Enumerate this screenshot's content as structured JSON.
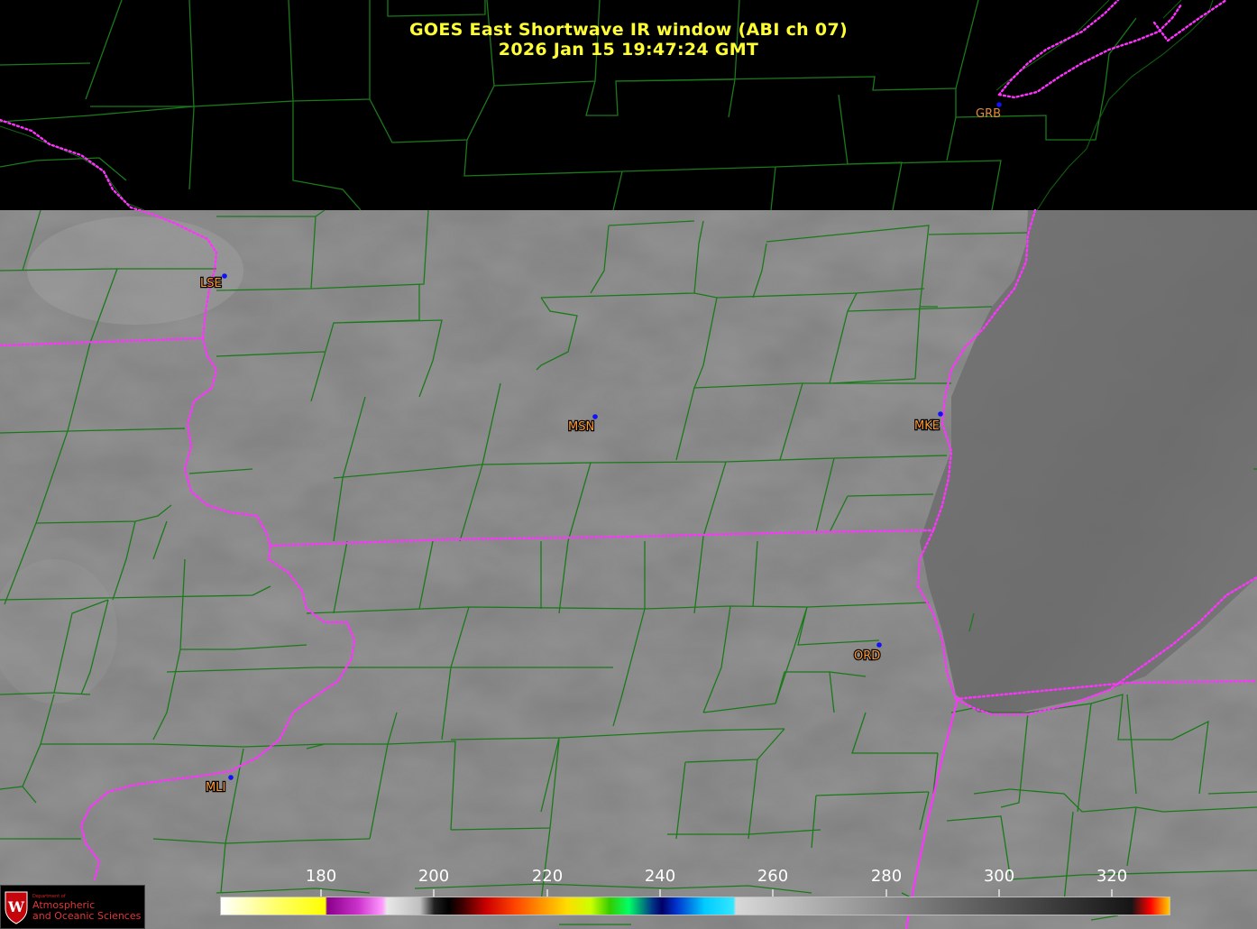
{
  "title": {
    "line1": "GOES East Shortwave IR window (ABI ch 07)",
    "line2": "2026 Jan 15  19:47:24 GMT"
  },
  "stations": [
    {
      "id": "GRB"
    },
    {
      "id": "LSE"
    },
    {
      "id": "MSN"
    },
    {
      "id": "MKE"
    },
    {
      "id": "ORD"
    },
    {
      "id": "MLI"
    }
  ],
  "colorbar": {
    "unit_hint": "brightness temperature scale",
    "ticks": [
      "180",
      "200",
      "220",
      "240",
      "260",
      "280",
      "300",
      "320"
    ],
    "range": [
      164,
      330
    ]
  },
  "logo": {
    "dept_text": "Department of",
    "line1": "Atmospheric",
    "line2": "and Oceanic Sciences"
  },
  "colors": {
    "title": "#ffff33",
    "county_lines": "#1a7a1a",
    "state_lines": "#ff33ff",
    "station_label": "#ff9a33",
    "station_dot": "#1010ff"
  }
}
